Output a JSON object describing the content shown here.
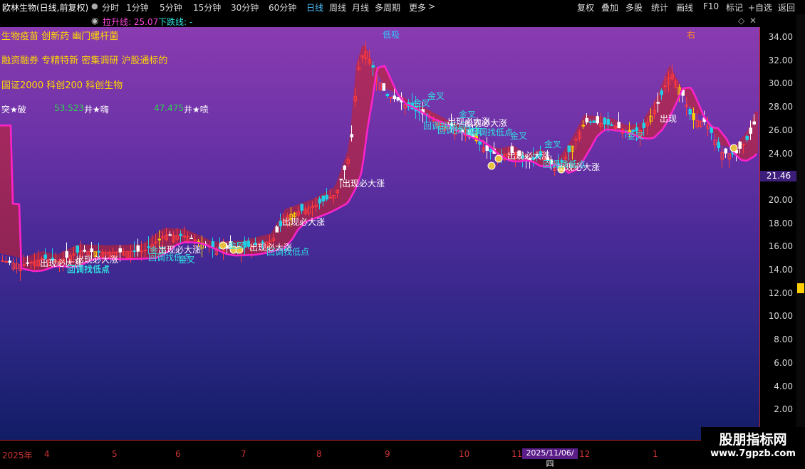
{
  "window": {
    "title": "欧林生物(日线,前复权)",
    "tabs": [
      "分时",
      "1分钟",
      "5分钟",
      "15分钟",
      "30分钟",
      "60分钟",
      "日线",
      "周线",
      "月线",
      "多周期",
      "更多"
    ],
    "active_tab": "日线",
    "more_arrow": ">",
    "toolbar": [
      "复权",
      "叠加",
      "多股",
      "统计",
      "画线",
      "F10",
      "标记",
      "+自选",
      "返回"
    ]
  },
  "indicator_bar": {
    "up_label": "拉升线: 25.07",
    "down_label": "下跌线: -",
    "diamond_glyph": "◇",
    "close_glyph": "✕"
  },
  "plot": {
    "notes": [
      {
        "text": "生物疫苗 创新药 幽门螺杆菌",
        "color": "#ffd800"
      },
      {
        "text": "融资融券 专精特新 密集调研 沪股通标的",
        "color": "#ffd800"
      },
      {
        "text": "国证2000 科创200 科创生物",
        "color": "#ffd800"
      }
    ],
    "stat_row": [
      {
        "text": "突★破",
        "color": "#ffffff"
      },
      {
        "text": "53.523",
        "color": "#2cd84a"
      },
      {
        "text": "井★嗨",
        "color": "#ffffff"
      },
      {
        "text": "47.475",
        "color": "#2cd84a"
      },
      {
        "text": "井★喷",
        "color": "#ffffff"
      }
    ],
    "top_labels": {
      "low_buy": "低吸",
      "right": "右"
    },
    "annotations": [
      {
        "text": "出现必大涨",
        "color": "#ffffff"
      },
      {
        "text": "回调找低点",
        "color": "#30e0e0"
      },
      {
        "text": "出现必大涨",
        "color": "#ffffff"
      },
      {
        "text": "回调找低点",
        "color": "#30e0e0"
      },
      {
        "text": "金叉",
        "color": "#30e0e0"
      },
      {
        "text": "出现必大涨",
        "color": "#ffffff"
      },
      {
        "text": "回调找低点",
        "color": "#30e0e0"
      },
      {
        "text": "金叉",
        "color": "#30e0e0"
      },
      {
        "text": "金叉",
        "color": "#30e0e0"
      },
      {
        "text": "出现必大涨",
        "color": "#ffffff"
      },
      {
        "text": "回调找低点",
        "color": "#30e0e0"
      },
      {
        "text": "出现必大涨",
        "color": "#ffffff"
      },
      {
        "text": "出现必大涨",
        "color": "#ffffff"
      },
      {
        "text": "金叉",
        "color": "#30e0e0"
      },
      {
        "text": "回调找低点",
        "color": "#30e0e0"
      },
      {
        "text": "金叉",
        "color": "#30e0e0"
      },
      {
        "text": "出现必大涨",
        "color": "#ffffff"
      },
      {
        "text": "回调找低点",
        "color": "#30e0e0"
      },
      {
        "text": "金叉",
        "color": "#30e0e0"
      },
      {
        "text": "出现必大涨",
        "color": "#ffffff"
      },
      {
        "text": "金叉",
        "color": "#30e0e0"
      },
      {
        "text": "回调找低点",
        "color": "#30e0e0"
      },
      {
        "text": "出现必大涨",
        "color": "#ffffff"
      },
      {
        "text": "金叉",
        "color": "#30e0e0"
      },
      {
        "text": "出现必大涨",
        "color": "#ffffff"
      },
      {
        "text": "回调找低点",
        "color": "#30e0e0"
      },
      {
        "text": "金叉",
        "color": "#30e0e0"
      },
      {
        "text": "金叉",
        "color": "#30e0e0"
      },
      {
        "text": "出现",
        "color": "#ffffff"
      }
    ]
  },
  "y_axis": {
    "ticks": [
      "34.00",
      "32.00",
      "30.00",
      "28.00",
      "26.00",
      "24.00",
      "22.00",
      "20.00",
      "18.00",
      "16.00",
      "14.00",
      "12.00",
      "10.00",
      "8.00",
      "6.00",
      "4.00",
      "2.00"
    ],
    "current_price": "21.46"
  },
  "x_axis": {
    "labels": [
      "2025年",
      "4",
      "5",
      "6",
      "7",
      "8",
      "9",
      "10",
      "11",
      "12",
      "1"
    ],
    "cursor_date": "2025/11/06/四"
  },
  "watermark": {
    "name": "股朋指标网",
    "url": "www.7gpzb.com"
  },
  "colors": {
    "up": "#ff3b3b",
    "down": "#1fd0e8",
    "ma_up": "#ff22cc",
    "ma_down": "#2b6cff",
    "ribbon_bull": "#d02020",
    "ribbon_bear": "#0b8a5a",
    "yellow_bar": "#ffd000"
  }
}
